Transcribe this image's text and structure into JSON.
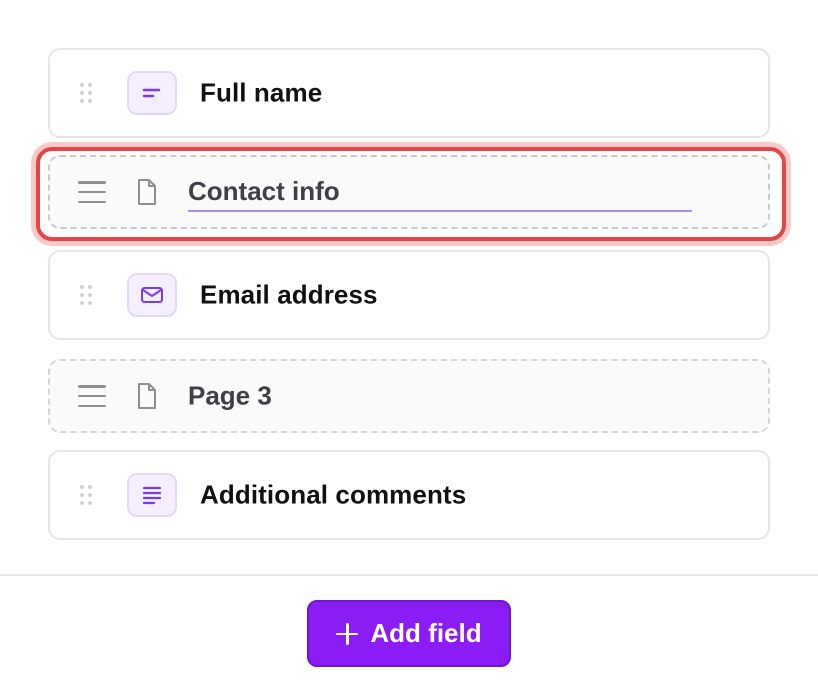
{
  "items": [
    {
      "kind": "field",
      "label": "Full name",
      "icon": "short-text-icon"
    },
    {
      "kind": "page",
      "label": "Contact info",
      "icon": "document-icon",
      "selected": true,
      "editing": true
    },
    {
      "kind": "field",
      "label": "Email address",
      "icon": "envelope-icon"
    },
    {
      "kind": "page",
      "label": "Page 3",
      "icon": "document-icon"
    },
    {
      "kind": "field",
      "label": "Additional comments",
      "icon": "long-text-icon"
    }
  ],
  "footer": {
    "add_button_label": "Add field"
  },
  "colors": {
    "accent": "#8b1cf6",
    "selection_ring": "#e64545",
    "icon_purple": "#7c3aed",
    "badge_bg": "#f3efff"
  }
}
